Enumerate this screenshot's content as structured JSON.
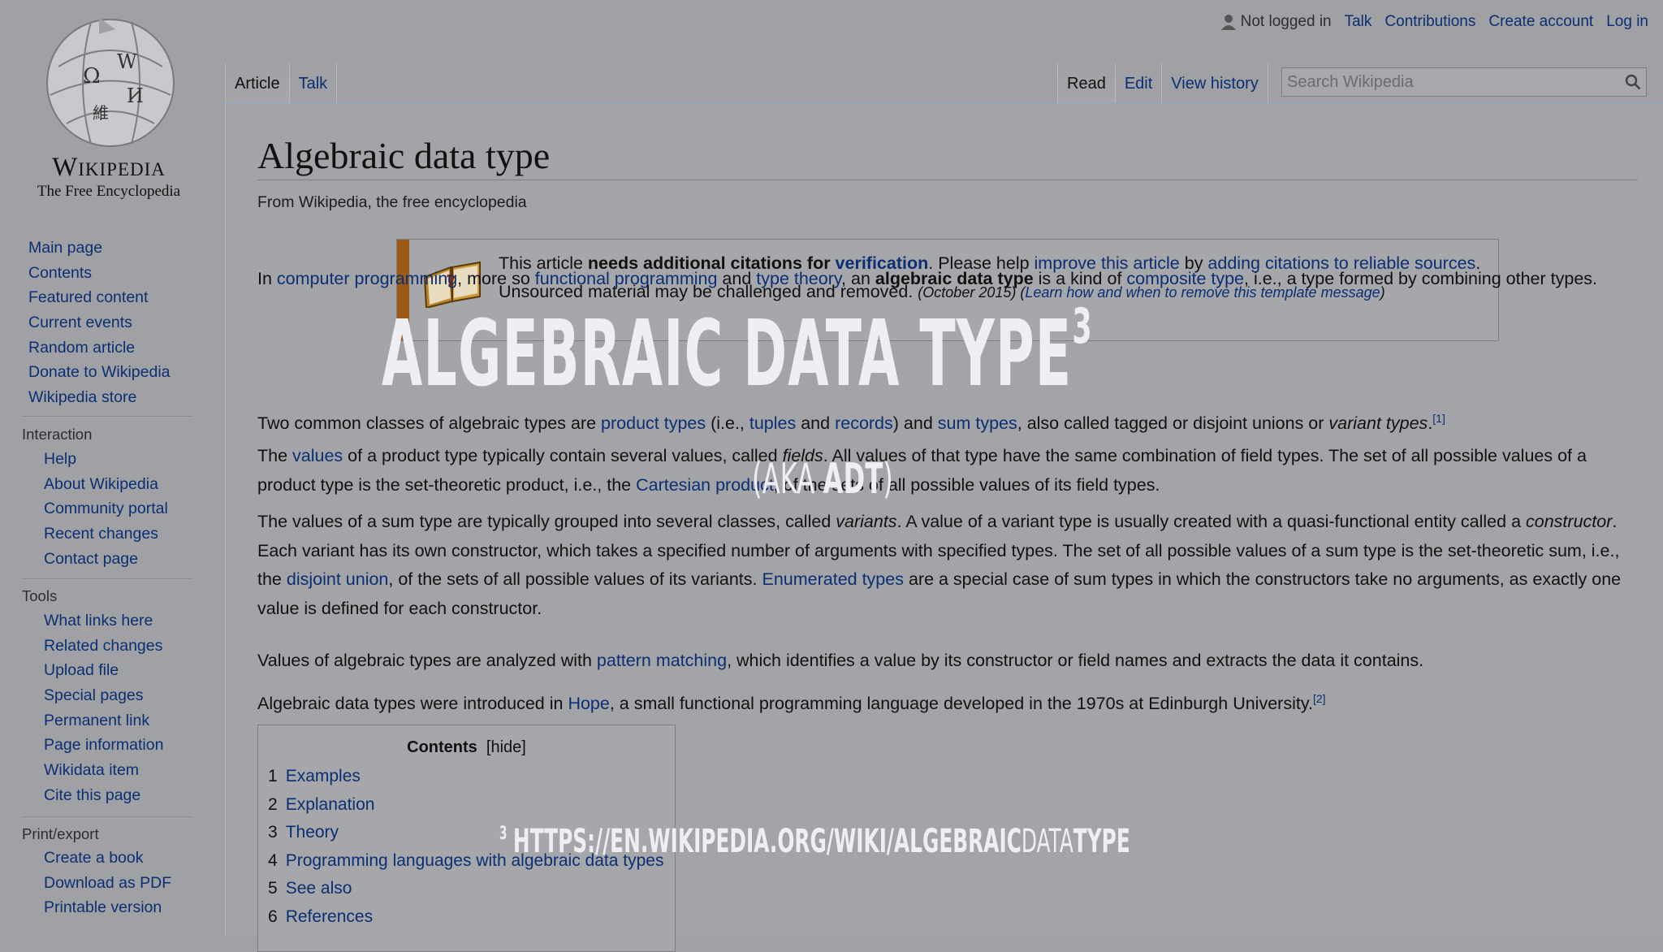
{
  "logo": {
    "wordmark": "Wikipedia",
    "tagline": "The Free Encyclopedia"
  },
  "nav_main": [
    "Main page",
    "Contents",
    "Featured content",
    "Current events",
    "Random article",
    "Donate to Wikipedia",
    "Wikipedia store"
  ],
  "interaction": {
    "heading": "Interaction",
    "items": [
      "Help",
      "About Wikipedia",
      "Community portal",
      "Recent changes",
      "Contact page"
    ]
  },
  "tools": {
    "heading": "Tools",
    "items": [
      "What links here",
      "Related changes",
      "Upload file",
      "Special pages",
      "Permanent link",
      "Page information",
      "Wikidata item",
      "Cite this page"
    ]
  },
  "print_export": {
    "heading": "Print/export",
    "items": [
      "Create a book",
      "Download as PDF",
      "Printable version"
    ]
  },
  "personal": {
    "not_logged_in": "Not logged in",
    "talk": "Talk",
    "contributions": "Contributions",
    "create_account": "Create account",
    "log_in": "Log in"
  },
  "tabs_left": [
    "Article",
    "Talk"
  ],
  "tabs_right": [
    "Read",
    "Edit",
    "View history"
  ],
  "search": {
    "placeholder": "Search Wikipedia"
  },
  "article": {
    "title": "Algebraic data type",
    "site_sub": "From Wikipedia, the free encyclopedia",
    "ambox": {
      "t1": "This article ",
      "b1": "needs additional citations for ",
      "l1": "verification",
      "t2": ". Please help ",
      "l2": "improve this article",
      "t3": " by ",
      "l3": "adding citations to reliable sources",
      "t4": ". Unsourced material may be challenged and removed. ",
      "date": "(October 2015)",
      "t5": " (",
      "l4": "Learn how and when to remove this template message",
      "t6": ")"
    },
    "p1": {
      "a": "In ",
      "l1": "computer programming",
      "b": ", more so ",
      "l2": "functional programming",
      "c": " and ",
      "l3": "type theory",
      "d": ", an ",
      "bold": "algebraic data type",
      "e": " is a kind of ",
      "l4": "composite type",
      "f": ", i.e., a type formed by combining other types."
    },
    "p2": {
      "a": "Two common classes of algebraic types are ",
      "l1": "product types",
      "b": " (i.e., ",
      "l2": "tuples",
      "c": " and ",
      "l3": "records",
      "d": ") and ",
      "l4": "sum types",
      "e": ", also called tagged or disjoint unions or ",
      "it": "variant types",
      "f": ".",
      "ref": "[1]"
    },
    "p3": {
      "a": "The ",
      "l1": "values",
      "b": " of a product type typically contain several values, called ",
      "it": "fields",
      "c": ". All values of that type have the same combination of field types. The set of all possible values of a product type is the set-theoretic product, i.e., the ",
      "l2": "Cartesian product",
      "d": ", of the sets of all possible values of its field types."
    },
    "p4": {
      "a": "The values of a sum type are typically grouped into several classes, called ",
      "it1": "variants",
      "b": ". A value of a variant type is usually created with a quasi-functional entity called a ",
      "it2": "constructor",
      "c": ". Each variant has its own constructor, which takes a specified number of arguments with specified types. The set of all possible values of a sum type is the set-theoretic sum, i.e., the ",
      "l1": "disjoint union",
      "d": ", of the sets of all possible values of its variants. ",
      "l2": "Enumerated types",
      "e": " are a special case of sum types in which the constructors take no arguments, as exactly one value is defined for each constructor."
    },
    "p5": {
      "a": "Values of algebraic types are analyzed with ",
      "l1": "pattern matching",
      "b": ", which identifies a value by its constructor or field names and extracts the data it contains."
    },
    "p6": {
      "a": "Algebraic data types were introduced in ",
      "l1": "Hope",
      "b": ", a small functional programming language developed in the 1970s at Edinburgh University.",
      "ref": "[2]"
    }
  },
  "toc": {
    "title": "Contents",
    "hide": "[hide]",
    "items": [
      {
        "num": "1",
        "label": "Examples"
      },
      {
        "num": "2",
        "label": "Explanation"
      },
      {
        "num": "3",
        "label": "Theory"
      },
      {
        "num": "4",
        "label": "Programming languages with algebraic data types"
      },
      {
        "num": "5",
        "label": "See also"
      },
      {
        "num": "6",
        "label": "References"
      }
    ]
  },
  "overlay": {
    "title": "ALGEBRAIC DATA TYPE",
    "title_sup": "3",
    "sub_a": "(AKA ",
    "sub_b": "ADT",
    "sub_c": ")",
    "footnote_num": "3",
    "footnote_a": "HTTPS://EN.WIKIPEDIA.ORG/WIKI/ALGEBRAIC",
    "footnote_b": "DATA",
    "footnote_c": "TYPE"
  }
}
